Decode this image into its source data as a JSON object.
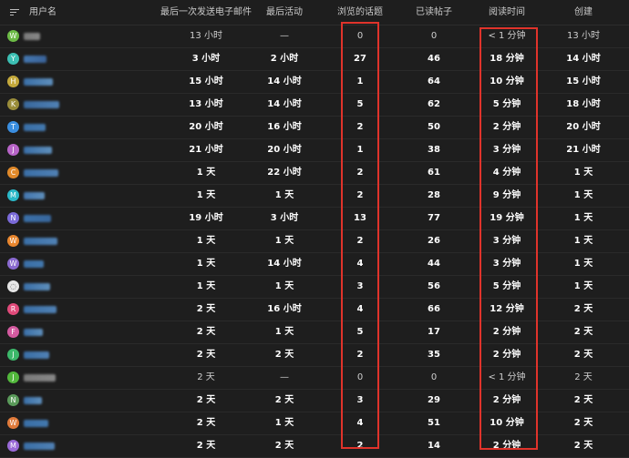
{
  "header": {
    "username": "用户名",
    "last_email": "最后一次发送电子邮件",
    "last_activity": "最后活动",
    "topics_viewed": "浏览的话题",
    "posts_read": "已读帖子",
    "read_time": "阅读时间",
    "created": "创建"
  },
  "rows": [
    {
      "avatar": "W",
      "color": "#6cbb46",
      "blur": [
        "#8a8a8a",
        "#9a9a9a"
      ],
      "last_email": "13 小时",
      "last_activity": "—",
      "topics": "0",
      "posts": "0",
      "read_time": "< 1 分钟",
      "created": "13 小时",
      "bold": false
    },
    {
      "avatar": "Y",
      "color": "#3cbfb3",
      "blur": [
        "#4b86c9",
        "#3f6fae"
      ],
      "last_email": "3 小时",
      "last_activity": "2 小时",
      "topics": "27",
      "posts": "46",
      "read_time": "18 分钟",
      "created": "14 小时",
      "bold": true
    },
    {
      "avatar": "H",
      "color": "#c4a93c",
      "blur": [
        "#3f7dbf",
        "#6aa3d8"
      ],
      "last_email": "15 小时",
      "last_activity": "14 小时",
      "topics": "1",
      "posts": "64",
      "read_time": "10 分钟",
      "created": "15 小时",
      "bold": true
    },
    {
      "avatar": "K",
      "color": "#9a8d3a",
      "blur": [
        "#3d74b3",
        "#5a93cf"
      ],
      "last_email": "13 小时",
      "last_activity": "14 小时",
      "topics": "5",
      "posts": "62",
      "read_time": "5 分钟",
      "created": "18 小时",
      "bold": true
    },
    {
      "avatar": "T",
      "color": "#3a8ee0",
      "blur": [
        "#3f7dbf",
        "#4a89c8"
      ],
      "last_email": "20 小时",
      "last_activity": "16 小时",
      "topics": "2",
      "posts": "50",
      "read_time": "2 分钟",
      "created": "20 小时",
      "bold": true
    },
    {
      "avatar": "J",
      "color": "#b865c8",
      "blur": [
        "#3f7dbf",
        "#6aa3d8"
      ],
      "last_email": "21 小时",
      "last_activity": "20 小时",
      "topics": "1",
      "posts": "38",
      "read_time": "3 分钟",
      "created": "21 小时",
      "bold": true
    },
    {
      "avatar": "C",
      "color": "#e0892a",
      "blur": [
        "#3f7dbf",
        "#5a93cf"
      ],
      "last_email": "1 天",
      "last_activity": "22 小时",
      "topics": "2",
      "posts": "61",
      "read_time": "4 分钟",
      "created": "1 天",
      "bold": true
    },
    {
      "avatar": "M",
      "color": "#2ab8c8",
      "blur": [
        "#4b86c9",
        "#6aa3d8"
      ],
      "last_email": "1 天",
      "last_activity": "1 天",
      "topics": "2",
      "posts": "28",
      "read_time": "9 分钟",
      "created": "1 天",
      "bold": true
    },
    {
      "avatar": "N",
      "color": "#7a6ad8",
      "blur": [
        "#3f7dbf",
        "#3d74b3"
      ],
      "last_email": "19 小时",
      "last_activity": "3 小时",
      "topics": "13",
      "posts": "77",
      "read_time": "19 分钟",
      "created": "1 天",
      "bold": true
    },
    {
      "avatar": "W",
      "color": "#e8862e",
      "blur": [
        "#3f7dbf",
        "#5a93cf"
      ],
      "last_email": "1 天",
      "last_activity": "1 天",
      "topics": "2",
      "posts": "26",
      "read_time": "3 分钟",
      "created": "1 天",
      "bold": true
    },
    {
      "avatar": "W",
      "color": "#8a6ad0",
      "blur": [
        "#3f7dbf",
        "#4a89c8"
      ],
      "last_email": "1 天",
      "last_activity": "14 小时",
      "topics": "4",
      "posts": "44",
      "read_time": "3 分钟",
      "created": "1 天",
      "bold": true
    },
    {
      "avatar": "◌",
      "color": "#e6e6e6",
      "blur": [
        "#3f7dbf",
        "#6aa3d8"
      ],
      "last_email": "1 天",
      "last_activity": "1 天",
      "topics": "3",
      "posts": "56",
      "read_time": "5 分钟",
      "created": "1 天",
      "bold": true
    },
    {
      "avatar": "R",
      "color": "#e04a7a",
      "blur": [
        "#3f7dbf",
        "#5a93cf"
      ],
      "last_email": "2 天",
      "last_activity": "16 小时",
      "topics": "4",
      "posts": "66",
      "read_time": "12 分钟",
      "created": "2 天",
      "bold": true
    },
    {
      "avatar": "F",
      "color": "#d45aa0",
      "blur": [
        "#3f7dbf",
        "#6aa3d8"
      ],
      "last_email": "2 天",
      "last_activity": "1 天",
      "topics": "5",
      "posts": "17",
      "read_time": "2 分钟",
      "created": "2 天",
      "bold": true
    },
    {
      "avatar": "J",
      "color": "#3cb86a",
      "blur": [
        "#3f7dbf",
        "#5a93cf"
      ],
      "last_email": "2 天",
      "last_activity": "2 天",
      "topics": "2",
      "posts": "35",
      "read_time": "2 分钟",
      "created": "2 天",
      "bold": true
    },
    {
      "avatar": "J",
      "color": "#52b83c",
      "blur": [
        "#8a8a8a",
        "#9a9a9a"
      ],
      "last_email": "2 天",
      "last_activity": "—",
      "topics": "0",
      "posts": "0",
      "read_time": "< 1 分钟",
      "created": "2 天",
      "bold": false
    },
    {
      "avatar": "N",
      "color": "#5a9a5a",
      "blur": [
        "#3f7dbf",
        "#6aa3d8"
      ],
      "last_email": "2 天",
      "last_activity": "2 天",
      "topics": "3",
      "posts": "29",
      "read_time": "2 分钟",
      "created": "2 天",
      "bold": true
    },
    {
      "avatar": "W",
      "color": "#e07a3a",
      "blur": [
        "#3f7dbf",
        "#4a89c8"
      ],
      "last_email": "2 天",
      "last_activity": "1 天",
      "topics": "4",
      "posts": "51",
      "read_time": "10 分钟",
      "created": "2 天",
      "bold": true
    },
    {
      "avatar": "M",
      "color": "#9a6ad8",
      "blur": [
        "#3f7dbf",
        "#5a93cf"
      ],
      "last_email": "2 天",
      "last_activity": "2 天",
      "topics": "2",
      "posts": "14",
      "read_time": "2 分钟",
      "created": "2 天",
      "bold": true
    }
  ],
  "highlight_color": "#e0332b"
}
